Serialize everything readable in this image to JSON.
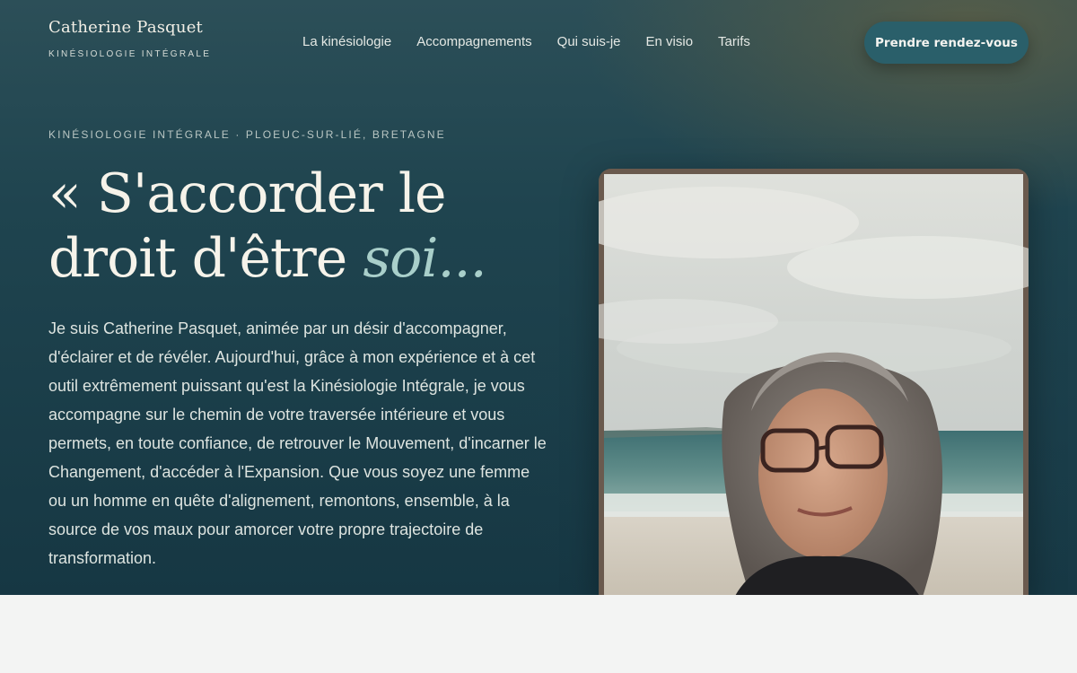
{
  "brand": {
    "name": "Catherine Pasquet",
    "tagline": "Kinésiologie Intégrale"
  },
  "nav": {
    "items": [
      {
        "label": "La kinésiologie"
      },
      {
        "label": "Accompagnements"
      },
      {
        "label": "Qui suis-je"
      },
      {
        "label": "En visio"
      },
      {
        "label": "Tarifs"
      }
    ],
    "cta_label": "Prendre rendez-vous"
  },
  "hero": {
    "eyebrow": "Kinésiologie Intégrale · Ploeuc-sur-Lié, Bretagne",
    "headline_line1": "« S'accorder le",
    "headline_line2": "droit d'être ",
    "headline_accent": "soi...",
    "intro": "Je suis Catherine Pasquet, animée par un désir d'accompagner, d'éclairer et de révéler. Aujourd'hui, grâce à mon expérience et à cet outil extrêmement puissant qu'est la Kinésiologie Intégrale, je vous accompagne sur le chemin de votre traversée intérieure et vous permets, en toute confiance, de retrouver le Mouvement, d'incarner le Changement, d'accéder à l'Expansion. Que vous soyez une femme ou un homme en quête d'alignement, remontons, ensemble, à la source de vos maux pour amorcer votre propre trajectoire de transformation."
  },
  "colors": {
    "hero_bg": "#1f444f",
    "accent": "#a9cfca",
    "cta_bg": "#2a5f6a",
    "page_bg": "#f3f4f3"
  }
}
